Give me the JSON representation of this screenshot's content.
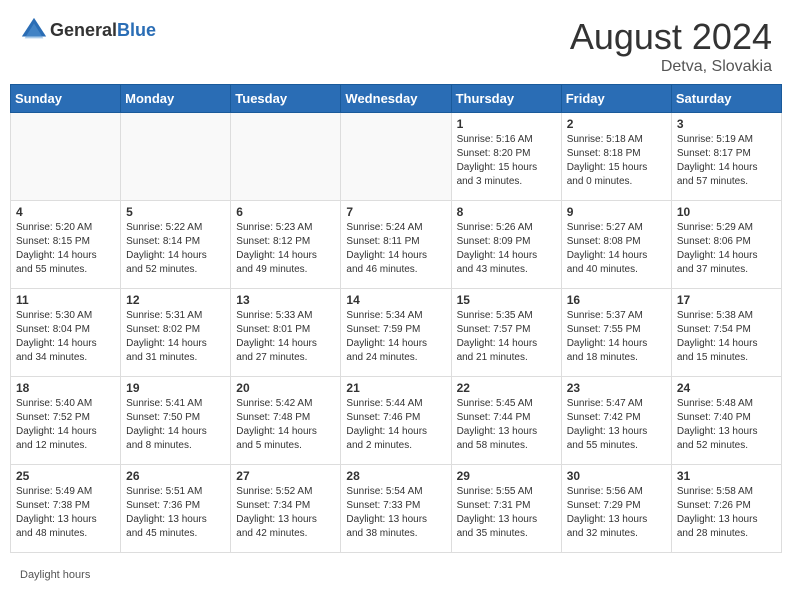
{
  "header": {
    "logo_general": "General",
    "logo_blue": "Blue",
    "month_year": "August 2024",
    "location": "Detva, Slovakia"
  },
  "footer": {
    "daylight_label": "Daylight hours"
  },
  "weekdays": [
    "Sunday",
    "Monday",
    "Tuesday",
    "Wednesday",
    "Thursday",
    "Friday",
    "Saturday"
  ],
  "weeks": [
    [
      {
        "day": "",
        "empty": true
      },
      {
        "day": "",
        "empty": true
      },
      {
        "day": "",
        "empty": true
      },
      {
        "day": "",
        "empty": true
      },
      {
        "day": "1",
        "sunrise": "5:16 AM",
        "sunset": "8:20 PM",
        "daylight": "15 hours and 3 minutes."
      },
      {
        "day": "2",
        "sunrise": "5:18 AM",
        "sunset": "8:18 PM",
        "daylight": "15 hours and 0 minutes."
      },
      {
        "day": "3",
        "sunrise": "5:19 AM",
        "sunset": "8:17 PM",
        "daylight": "14 hours and 57 minutes."
      }
    ],
    [
      {
        "day": "4",
        "sunrise": "5:20 AM",
        "sunset": "8:15 PM",
        "daylight": "14 hours and 55 minutes."
      },
      {
        "day": "5",
        "sunrise": "5:22 AM",
        "sunset": "8:14 PM",
        "daylight": "14 hours and 52 minutes."
      },
      {
        "day": "6",
        "sunrise": "5:23 AM",
        "sunset": "8:12 PM",
        "daylight": "14 hours and 49 minutes."
      },
      {
        "day": "7",
        "sunrise": "5:24 AM",
        "sunset": "8:11 PM",
        "daylight": "14 hours and 46 minutes."
      },
      {
        "day": "8",
        "sunrise": "5:26 AM",
        "sunset": "8:09 PM",
        "daylight": "14 hours and 43 minutes."
      },
      {
        "day": "9",
        "sunrise": "5:27 AM",
        "sunset": "8:08 PM",
        "daylight": "14 hours and 40 minutes."
      },
      {
        "day": "10",
        "sunrise": "5:29 AM",
        "sunset": "8:06 PM",
        "daylight": "14 hours and 37 minutes."
      }
    ],
    [
      {
        "day": "11",
        "sunrise": "5:30 AM",
        "sunset": "8:04 PM",
        "daylight": "14 hours and 34 minutes."
      },
      {
        "day": "12",
        "sunrise": "5:31 AM",
        "sunset": "8:02 PM",
        "daylight": "14 hours and 31 minutes."
      },
      {
        "day": "13",
        "sunrise": "5:33 AM",
        "sunset": "8:01 PM",
        "daylight": "14 hours and 27 minutes."
      },
      {
        "day": "14",
        "sunrise": "5:34 AM",
        "sunset": "7:59 PM",
        "daylight": "14 hours and 24 minutes."
      },
      {
        "day": "15",
        "sunrise": "5:35 AM",
        "sunset": "7:57 PM",
        "daylight": "14 hours and 21 minutes."
      },
      {
        "day": "16",
        "sunrise": "5:37 AM",
        "sunset": "7:55 PM",
        "daylight": "14 hours and 18 minutes."
      },
      {
        "day": "17",
        "sunrise": "5:38 AM",
        "sunset": "7:54 PM",
        "daylight": "14 hours and 15 minutes."
      }
    ],
    [
      {
        "day": "18",
        "sunrise": "5:40 AM",
        "sunset": "7:52 PM",
        "daylight": "14 hours and 12 minutes."
      },
      {
        "day": "19",
        "sunrise": "5:41 AM",
        "sunset": "7:50 PM",
        "daylight": "14 hours and 8 minutes."
      },
      {
        "day": "20",
        "sunrise": "5:42 AM",
        "sunset": "7:48 PM",
        "daylight": "14 hours and 5 minutes."
      },
      {
        "day": "21",
        "sunrise": "5:44 AM",
        "sunset": "7:46 PM",
        "daylight": "14 hours and 2 minutes."
      },
      {
        "day": "22",
        "sunrise": "5:45 AM",
        "sunset": "7:44 PM",
        "daylight": "13 hours and 58 minutes."
      },
      {
        "day": "23",
        "sunrise": "5:47 AM",
        "sunset": "7:42 PM",
        "daylight": "13 hours and 55 minutes."
      },
      {
        "day": "24",
        "sunrise": "5:48 AM",
        "sunset": "7:40 PM",
        "daylight": "13 hours and 52 minutes."
      }
    ],
    [
      {
        "day": "25",
        "sunrise": "5:49 AM",
        "sunset": "7:38 PM",
        "daylight": "13 hours and 48 minutes."
      },
      {
        "day": "26",
        "sunrise": "5:51 AM",
        "sunset": "7:36 PM",
        "daylight": "13 hours and 45 minutes."
      },
      {
        "day": "27",
        "sunrise": "5:52 AM",
        "sunset": "7:34 PM",
        "daylight": "13 hours and 42 minutes."
      },
      {
        "day": "28",
        "sunrise": "5:54 AM",
        "sunset": "7:33 PM",
        "daylight": "13 hours and 38 minutes."
      },
      {
        "day": "29",
        "sunrise": "5:55 AM",
        "sunset": "7:31 PM",
        "daylight": "13 hours and 35 minutes."
      },
      {
        "day": "30",
        "sunrise": "5:56 AM",
        "sunset": "7:29 PM",
        "daylight": "13 hours and 32 minutes."
      },
      {
        "day": "31",
        "sunrise": "5:58 AM",
        "sunset": "7:26 PM",
        "daylight": "13 hours and 28 minutes."
      }
    ]
  ]
}
